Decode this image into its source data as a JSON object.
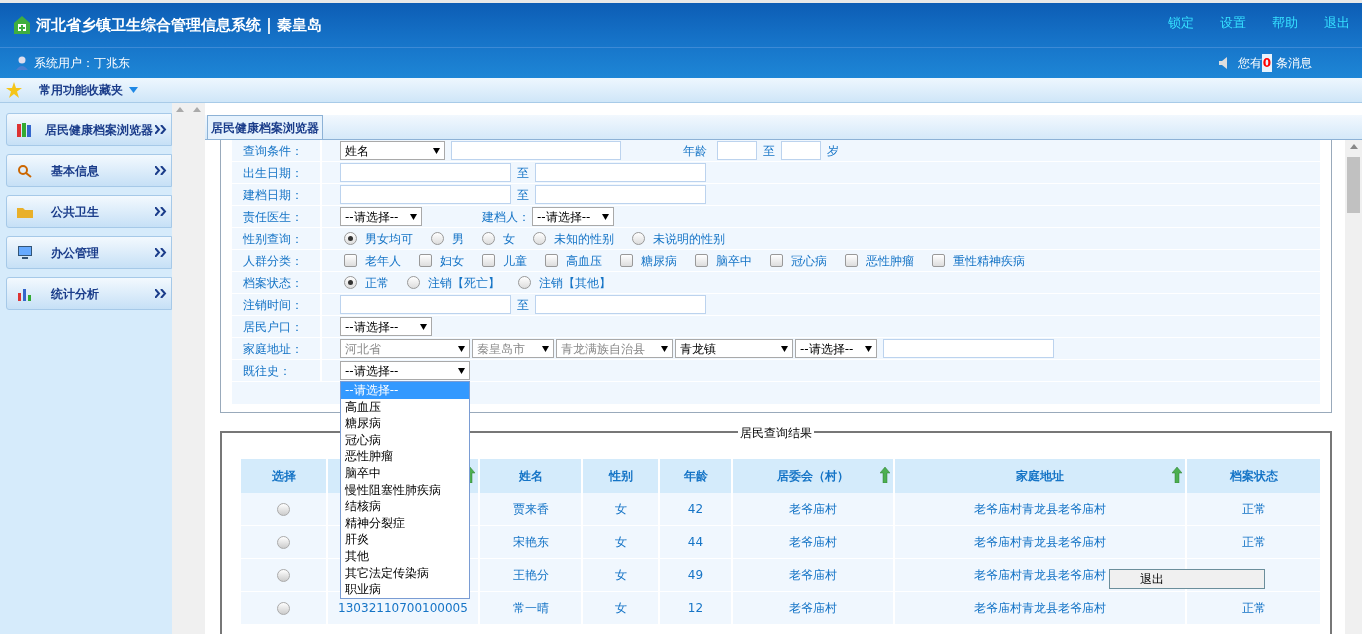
{
  "header": {
    "title": "河北省乡镇卫生综合管理信息系统 | 秦皇岛",
    "links": [
      "锁定",
      "设置",
      "帮助",
      "退出"
    ],
    "user": "系统用户：丁兆东",
    "msg_prefix": "您有",
    "msg_count": "0",
    "msg_suffix": " 条消息"
  },
  "favorites": {
    "label": "常用功能收藏夹"
  },
  "sidebar": {
    "items": [
      {
        "label": "居民健康档案浏览器"
      },
      {
        "label": "基本信息"
      },
      {
        "label": "公共卫生"
      },
      {
        "label": "办公管理"
      },
      {
        "label": "统计分析"
      }
    ]
  },
  "tabs": [
    {
      "label": "居民健康档案浏览器",
      "selected": true
    }
  ],
  "form": {
    "rows": [
      {
        "kind": "query",
        "label": "查询条件：",
        "select": "姓名",
        "age_label": "年龄",
        "to": "至",
        "unit": "岁"
      },
      {
        "kind": "range",
        "label": "出生日期：",
        "to": "至"
      },
      {
        "kind": "range",
        "label": "建档日期：",
        "to": "至"
      },
      {
        "kind": "selects",
        "label": "责任医生：",
        "select": "--请选择--",
        "label2": "建档人：",
        "select2": "--请选择--"
      },
      {
        "kind": "radios",
        "label": "性别查询：",
        "options": [
          {
            "label": "男女均可",
            "checked": true
          },
          {
            "label": "男",
            "checked": false
          },
          {
            "label": "女",
            "checked": false
          },
          {
            "label": "未知的性别",
            "checked": false
          },
          {
            "label": "未说明的性别",
            "checked": false
          }
        ]
      },
      {
        "kind": "checkboxes",
        "label": "人群分类：",
        "options": [
          {
            "label": "老年人",
            "checked": false
          },
          {
            "label": "妇女",
            "checked": false
          },
          {
            "label": "儿童",
            "checked": false
          },
          {
            "label": "高血压",
            "checked": false
          },
          {
            "label": "糖尿病",
            "checked": false
          },
          {
            "label": "脑卒中",
            "checked": false
          },
          {
            "label": "冠心病",
            "checked": false
          },
          {
            "label": "恶性肿瘤",
            "checked": false
          },
          {
            "label": "重性精神疾病",
            "checked": false
          }
        ]
      },
      {
        "kind": "radios",
        "label": "档案状态：",
        "options": [
          {
            "label": "正常",
            "checked": true
          },
          {
            "label": "注销【死亡】",
            "checked": false
          },
          {
            "label": "注销【其他】",
            "checked": false
          }
        ]
      },
      {
        "kind": "range",
        "label": "注销时间：",
        "to": "至"
      },
      {
        "kind": "select",
        "label": "居民户口：",
        "select": "--请选择--"
      },
      {
        "kind": "address",
        "label": "家庭地址：",
        "selects": [
          {
            "value": "河北省",
            "disabled": true
          },
          {
            "value": "秦皇岛市",
            "disabled": true
          },
          {
            "value": "青龙满族自治县",
            "disabled": true
          },
          {
            "value": "青龙镇",
            "disabled": false
          },
          {
            "value": "--请选择--",
            "disabled": false
          }
        ]
      },
      {
        "kind": "dropdown",
        "label": "既往史：",
        "select": "--请选择--",
        "options": [
          {
            "label": "--请选择--",
            "selected": true
          },
          {
            "label": "高血压",
            "selected": false
          },
          {
            "label": "糖尿病",
            "selected": false
          },
          {
            "label": "冠心病",
            "selected": false
          },
          {
            "label": "恶性肿瘤",
            "selected": false
          },
          {
            "label": "脑卒中",
            "selected": false
          },
          {
            "label": "慢性阻塞性肺疾病",
            "selected": false
          },
          {
            "label": "结核病",
            "selected": false
          },
          {
            "label": "精神分裂症",
            "selected": false
          },
          {
            "label": "肝炎",
            "selected": false
          },
          {
            "label": "其他",
            "selected": false
          },
          {
            "label": "其它法定传染病",
            "selected": false
          },
          {
            "label": "职业病",
            "selected": false
          }
        ]
      }
    ]
  },
  "results": {
    "legend": "居民查询结果",
    "columns": [
      {
        "label": "选择",
        "sortable": false
      },
      {
        "sortable": true
      },
      {
        "label": "姓名",
        "sortable": false
      },
      {
        "label": "性别",
        "sortable": false
      },
      {
        "label": "年龄",
        "sortable": false
      },
      {
        "label": "居委会（村）",
        "sortable": true
      },
      {
        "label": "家庭地址",
        "sortable": true
      },
      {
        "label": "档案状态",
        "sortable": false
      }
    ],
    "rows": [
      {
        "selected": false,
        "name": "贾来香",
        "sex": "女",
        "age": "42",
        "village": "老爷庙村",
        "address": "老爷庙村青龙县老爷庙村",
        "status": "正常"
      },
      {
        "selected": false,
        "name": "宋艳东",
        "sex": "女",
        "age": "44",
        "village": "老爷庙村",
        "address": "老爷庙村青龙县老爷庙村",
        "status": "正常"
      },
      {
        "selected": false,
        "name": "王艳分",
        "sex": "女",
        "age": "49",
        "village": "老爷庙村",
        "address": "老爷庙村青龙县老爷庙村"
      },
      {
        "selected": false,
        "id": "13032110700100005",
        "name": "常一晴",
        "sex": "女",
        "age": "12",
        "village": "老爷庙村",
        "address": "老爷庙村青龙县老爷庙村",
        "status": "正常"
      }
    ]
  },
  "context_menu": {
    "items": [
      "退出"
    ]
  }
}
